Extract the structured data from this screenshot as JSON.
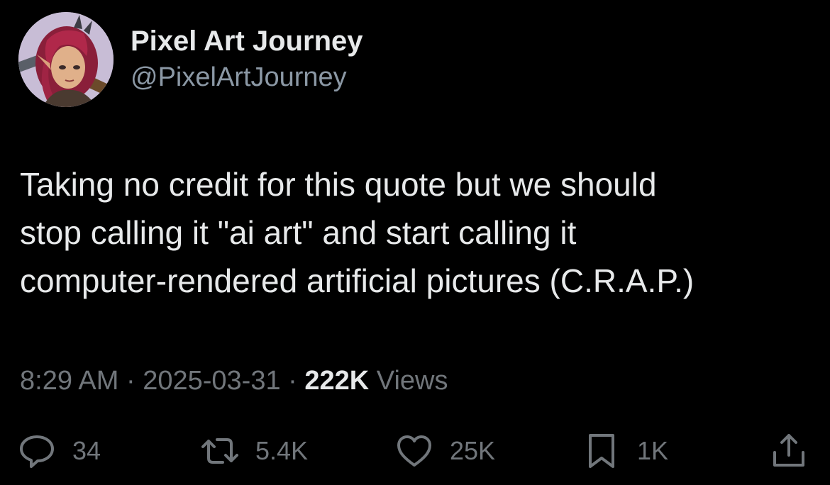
{
  "author": {
    "display_name": "Pixel Art Journey",
    "handle": "@PixelArtJourney"
  },
  "tweet": {
    "text_lines": [
      "Taking no credit for this quote but we should",
      "stop calling it \"ai art\" and start calling it",
      "computer-rendered artificial pictures (C.R.A.P.)"
    ],
    "time": "8:29 AM",
    "separator": "·",
    "date": "2025-03-31",
    "views_count": "222K",
    "views_label": "Views"
  },
  "actions": {
    "replies": "34",
    "reposts": "5.4K",
    "likes": "25K",
    "bookmarks": "1K"
  },
  "icons": {
    "reply": "speech-bubble-icon",
    "repost": "repost-arrows-icon",
    "like": "heart-icon",
    "bookmark": "bookmark-icon",
    "share": "share-upload-icon"
  },
  "colors": {
    "background": "#000000",
    "primary_text": "#e7e9ea",
    "secondary_text": "#71767b",
    "handle_text": "#8b98a5"
  }
}
